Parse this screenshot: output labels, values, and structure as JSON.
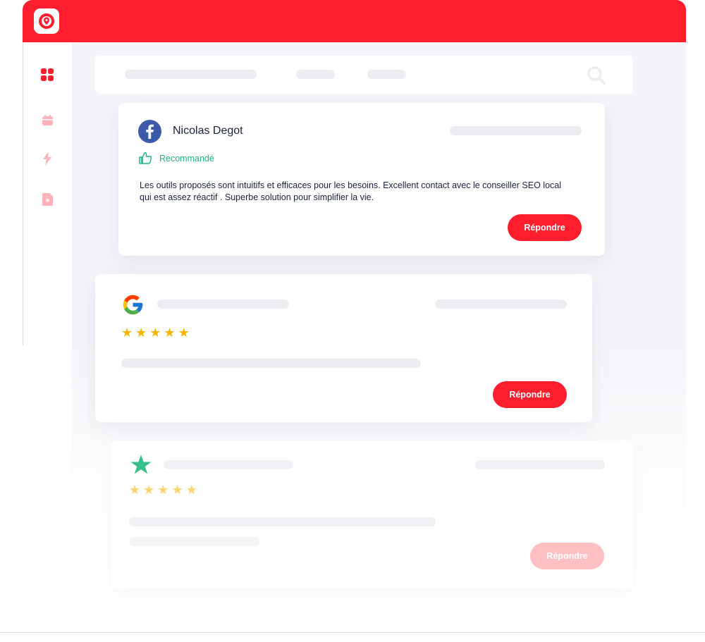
{
  "colors": {
    "brand_red": "#ff1e2d",
    "recommended_green": "#1fb580",
    "star_gold": "#f7b500"
  },
  "sidebar": {
    "icons": [
      "grid-icon",
      "calendar-icon",
      "bolt-icon",
      "document-icon"
    ]
  },
  "reviews": [
    {
      "source": "facebook",
      "author": "Nicolas Degot",
      "recommendation": "Recommandé",
      "text": "Les outils proposés sont intuitifs et efficaces pour les besoins. Excellent contact avec le conseiller SEO local qui est assez réactif . Superbe solution pour simplifier la vie.",
      "reply_label": "Répondre"
    },
    {
      "source": "google",
      "rating": 5,
      "reply_label": "Répondre"
    },
    {
      "source": "trustpilot",
      "rating": 5,
      "reply_label": "Répondre"
    }
  ]
}
